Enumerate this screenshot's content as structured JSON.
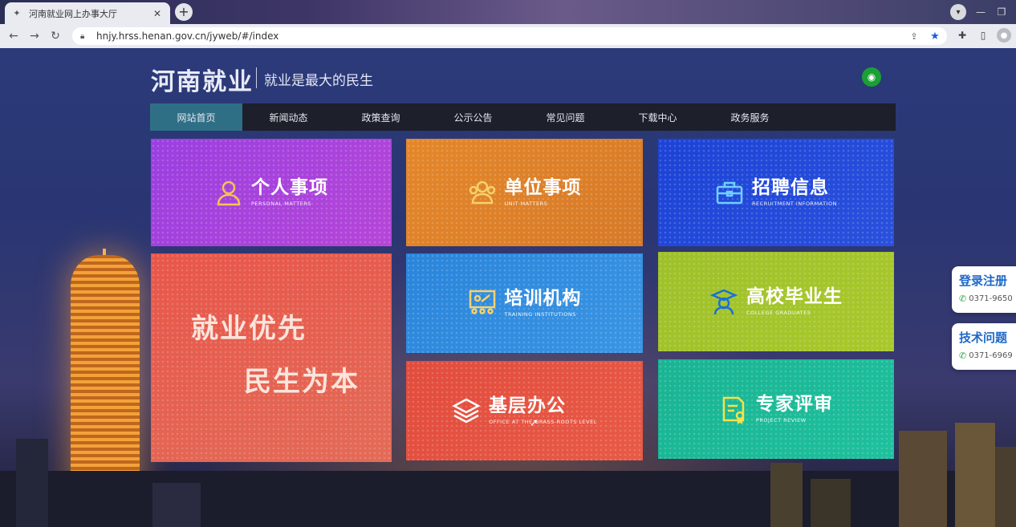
{
  "browser": {
    "tab_title": "河南就业网上办事大厅",
    "url": "hnjy.hrss.henan.gov.cn/jyweb/#/index"
  },
  "header": {
    "logo": "河南就业",
    "slogan": "就业是最大的民生"
  },
  "nav": {
    "items": [
      "网站首页",
      "新闻动态",
      "政策查询",
      "公示公告",
      "常见问题",
      "下载中心",
      "政务服务"
    ],
    "active_index": 0
  },
  "tiles": {
    "personal": {
      "cn": "个人事项",
      "en": "PERSONAL MATTERS",
      "color": "#9a3fe0"
    },
    "unit": {
      "cn": "单位事项",
      "en": "UNIT MATTERS",
      "color": "#e4872a"
    },
    "recruit": {
      "cn": "招聘信息",
      "en": "RECRUITMENT INFORMATION",
      "color": "#1c43d6"
    },
    "slogan": {
      "line1": "就业优先",
      "line2": "民生为本",
      "color": "#e8564a"
    },
    "training": {
      "cn": "培训机构",
      "en": "TRAINING INSTITUTIONS",
      "color": "#2a85db"
    },
    "graduates": {
      "cn": "高校毕业生",
      "en": "COLLEGE GRADUATES",
      "color": "#9ec12a"
    },
    "grassroots": {
      "cn": "基层办公",
      "en": "OFFICE AT THE GRASS-ROOTS LEVEL",
      "color": "#e24c3d"
    },
    "expert": {
      "cn": "专家评审",
      "en": "PROJECT REVIEW",
      "color": "#19b493"
    }
  },
  "side_panels": {
    "login": {
      "title": "登录注册",
      "phone": "0371-9650"
    },
    "tech": {
      "title": "技术问题",
      "phone": "0371-6969"
    }
  }
}
